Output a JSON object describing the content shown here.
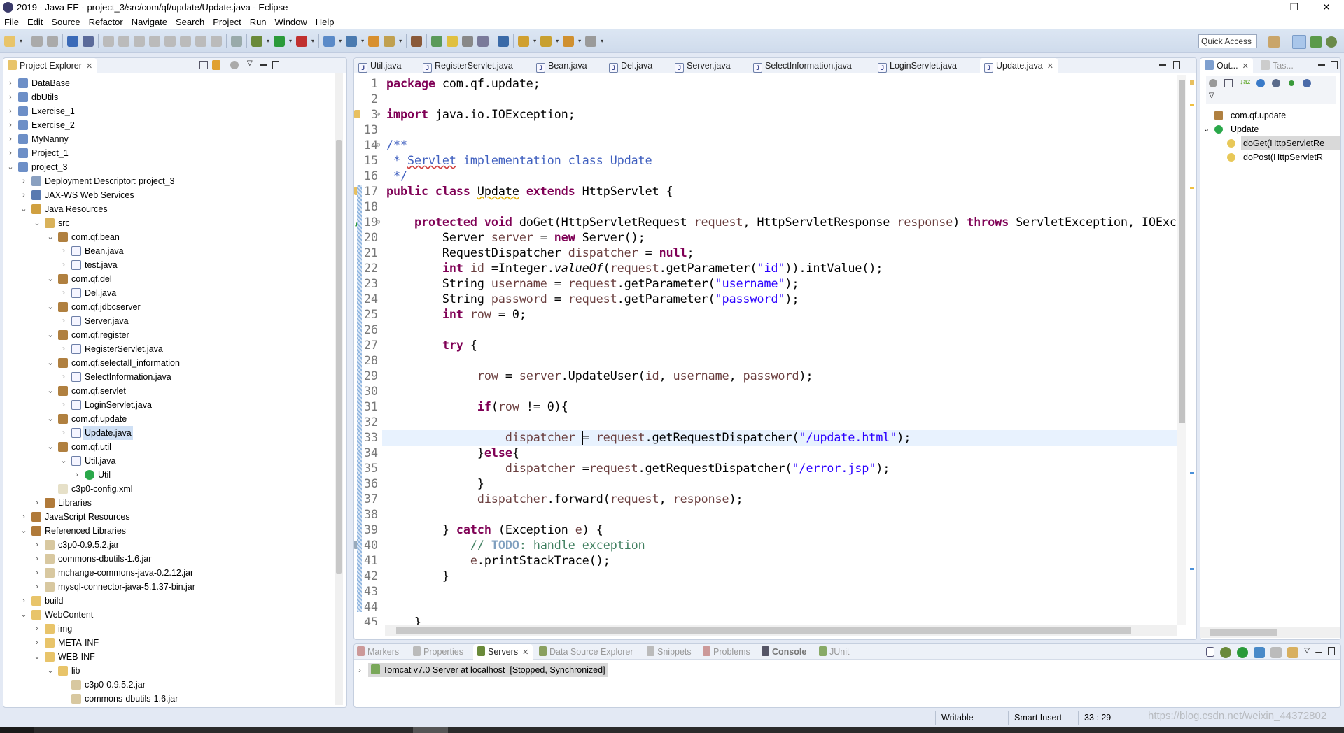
{
  "window": {
    "title": "2019 - Java EE - project_3/src/com/qf/update/Update.java - Eclipse"
  },
  "menu": [
    "File",
    "Edit",
    "Source",
    "Refactor",
    "Navigate",
    "Search",
    "Project",
    "Run",
    "Window",
    "Help"
  ],
  "toolbar": {
    "icons": [
      "new-icon",
      "save-icon",
      "save-all-icon",
      "open-perspective-icon",
      "skip-breakpoints-icon",
      "resume-icon",
      "suspend-icon",
      "terminate-icon",
      "disconnect-icon",
      "step-into-icon",
      "step-over-icon",
      "step-return-icon",
      "drop-to-frame-icon",
      "use-step-filters-icon",
      "debug-icon",
      "run-icon",
      "run-server-icon",
      "new-server-icon",
      "new-web-service-icon",
      "open-type-icon",
      "open-task-icon",
      "search-icon",
      "toggle-breadcrumb-icon",
      "mark-occurrences-icon",
      "block-selection-icon",
      "show-whitespace-icon",
      "web-browser-icon",
      "next-annotation-icon",
      "prev-annotation-icon",
      "back-icon",
      "forward-icon"
    ],
    "quick_access": "Quick Access"
  },
  "project_explorer": {
    "title": "Project Explorer",
    "items": [
      {
        "label": "DataBase",
        "level": 0,
        "expanded": false,
        "icon": "project"
      },
      {
        "label": "dbUtils",
        "level": 0,
        "expanded": false,
        "icon": "project"
      },
      {
        "label": "Exercise_1",
        "level": 0,
        "expanded": false,
        "icon": "project"
      },
      {
        "label": "Exercise_2",
        "level": 0,
        "expanded": false,
        "icon": "project"
      },
      {
        "label": "MyNanny",
        "level": 0,
        "expanded": false,
        "icon": "project"
      },
      {
        "label": "Project_1",
        "level": 0,
        "expanded": false,
        "icon": "project"
      },
      {
        "label": "project_3",
        "level": 0,
        "expanded": true,
        "icon": "project"
      },
      {
        "label": "Deployment Descriptor: project_3",
        "level": 1,
        "expanded": false,
        "icon": "descriptor"
      },
      {
        "label": "JAX-WS Web Services",
        "level": 1,
        "expanded": false,
        "icon": "webservice"
      },
      {
        "label": "Java Resources",
        "level": 1,
        "expanded": true,
        "icon": "resources"
      },
      {
        "label": "src",
        "level": 2,
        "expanded": true,
        "icon": "srcfolder"
      },
      {
        "label": "com.qf.bean",
        "level": 3,
        "expanded": true,
        "icon": "package"
      },
      {
        "label": "Bean.java",
        "level": 4,
        "expanded": false,
        "icon": "java"
      },
      {
        "label": "test.java",
        "level": 4,
        "expanded": false,
        "icon": "java"
      },
      {
        "label": "com.qf.del",
        "level": 3,
        "expanded": true,
        "icon": "package"
      },
      {
        "label": "Del.java",
        "level": 4,
        "expanded": false,
        "icon": "java"
      },
      {
        "label": "com.qf.jdbcserver",
        "level": 3,
        "expanded": true,
        "icon": "package"
      },
      {
        "label": "Server.java",
        "level": 4,
        "expanded": false,
        "icon": "java"
      },
      {
        "label": "com.qf.register",
        "level": 3,
        "expanded": true,
        "icon": "package"
      },
      {
        "label": "RegisterServlet.java",
        "level": 4,
        "expanded": false,
        "icon": "java"
      },
      {
        "label": "com.qf.selectall_information",
        "level": 3,
        "expanded": true,
        "icon": "package"
      },
      {
        "label": "SelectInformation.java",
        "level": 4,
        "expanded": false,
        "icon": "java"
      },
      {
        "label": "com.qf.servlet",
        "level": 3,
        "expanded": true,
        "icon": "package"
      },
      {
        "label": "LoginServlet.java",
        "level": 4,
        "expanded": false,
        "icon": "java"
      },
      {
        "label": "com.qf.update",
        "level": 3,
        "expanded": true,
        "icon": "package"
      },
      {
        "label": "Update.java",
        "level": 4,
        "expanded": false,
        "icon": "java",
        "selected": true
      },
      {
        "label": "com.qf.util",
        "level": 3,
        "expanded": true,
        "icon": "package"
      },
      {
        "label": "Util.java",
        "level": 4,
        "expanded": true,
        "icon": "java"
      },
      {
        "label": "Util",
        "level": 5,
        "expanded": false,
        "icon": "class"
      },
      {
        "label": "c3p0-config.xml",
        "level": 3,
        "expanded": null,
        "icon": "xml"
      },
      {
        "label": "Libraries",
        "level": 2,
        "expanded": false,
        "icon": "library"
      },
      {
        "label": "JavaScript Resources",
        "level": 1,
        "expanded": false,
        "icon": "library"
      },
      {
        "label": "Referenced Libraries",
        "level": 1,
        "expanded": true,
        "icon": "library"
      },
      {
        "label": "c3p0-0.9.5.2.jar",
        "level": 2,
        "expanded": false,
        "icon": "jar"
      },
      {
        "label": "commons-dbutils-1.6.jar",
        "level": 2,
        "expanded": false,
        "icon": "jar"
      },
      {
        "label": "mchange-commons-java-0.2.12.jar",
        "level": 2,
        "expanded": false,
        "icon": "jar"
      },
      {
        "label": "mysql-connector-java-5.1.37-bin.jar",
        "level": 2,
        "expanded": false,
        "icon": "jar"
      },
      {
        "label": "build",
        "level": 1,
        "expanded": false,
        "icon": "folder"
      },
      {
        "label": "WebContent",
        "level": 1,
        "expanded": true,
        "icon": "folder"
      },
      {
        "label": "img",
        "level": 2,
        "expanded": false,
        "icon": "folder"
      },
      {
        "label": "META-INF",
        "level": 2,
        "expanded": false,
        "icon": "folder"
      },
      {
        "label": "WEB-INF",
        "level": 2,
        "expanded": true,
        "icon": "folder"
      },
      {
        "label": "lib",
        "level": 3,
        "expanded": true,
        "icon": "folder"
      },
      {
        "label": "c3p0-0.9.5.2.jar",
        "level": 4,
        "expanded": null,
        "icon": "jar"
      },
      {
        "label": "commons-dbutils-1.6.jar",
        "level": 4,
        "expanded": null,
        "icon": "jar"
      }
    ]
  },
  "editor": {
    "tabs": [
      "Util.java",
      "RegisterServlet.java",
      "Bean.java",
      "Del.java",
      "Server.java",
      "SelectInformation.java",
      "LoginServlet.java",
      "Update.java"
    ],
    "active_tab": "Update.java",
    "current_line": 33,
    "lines": [
      {
        "n": 1,
        "segs": [
          [
            "k",
            "package"
          ],
          [
            "",
            " com.qf.update;"
          ]
        ]
      },
      {
        "n": 2,
        "segs": []
      },
      {
        "n": 3,
        "fold": "+",
        "segs": [
          [
            "k",
            "import"
          ],
          [
            "",
            " java.io.IOException;"
          ]
        ]
      },
      {
        "n": 13,
        "segs": []
      },
      {
        "n": 14,
        "fold": "-",
        "segs": [
          [
            "c",
            "/**"
          ]
        ]
      },
      {
        "n": 15,
        "segs": [
          [
            "c",
            " * "
          ],
          [
            "cu",
            "Servlet"
          ],
          [
            "c",
            " implementation class Update"
          ]
        ]
      },
      {
        "n": 16,
        "segs": [
          [
            "c",
            " */"
          ]
        ]
      },
      {
        "n": 17,
        "segs": [
          [
            "k",
            "public class "
          ],
          [
            "wu",
            "Update"
          ],
          [
            "k",
            " extends"
          ],
          [
            "",
            " HttpServlet {"
          ]
        ]
      },
      {
        "n": 18,
        "segs": []
      },
      {
        "n": 19,
        "fold": "-",
        "segs": [
          [
            "",
            "    "
          ],
          [
            "k",
            "protected void"
          ],
          [
            "",
            " doGet(HttpServletRequest "
          ],
          [
            "v",
            "request"
          ],
          [
            "",
            ", HttpServletResponse "
          ],
          [
            "v",
            "response"
          ],
          [
            "",
            ") "
          ],
          [
            "k",
            "throws"
          ],
          [
            "",
            " ServletException, IOException {"
          ]
        ]
      },
      {
        "n": 20,
        "segs": [
          [
            "",
            "        Server "
          ],
          [
            "v",
            "server"
          ],
          [
            "",
            " = "
          ],
          [
            "k",
            "new"
          ],
          [
            "",
            " Server();"
          ]
        ]
      },
      {
        "n": 21,
        "segs": [
          [
            "",
            "        RequestDispatcher "
          ],
          [
            "v",
            "dispatcher"
          ],
          [
            "",
            " = "
          ],
          [
            "k",
            "null"
          ],
          [
            "",
            ";"
          ]
        ]
      },
      {
        "n": 22,
        "segs": [
          [
            "",
            "        "
          ],
          [
            "k",
            "int"
          ],
          [
            "",
            " "
          ],
          [
            "v",
            "id"
          ],
          [
            "",
            " =Integer."
          ],
          [
            "it",
            "valueOf"
          ],
          [
            "",
            "("
          ],
          [
            "v",
            "request"
          ],
          [
            "",
            ".getParameter("
          ],
          [
            "s",
            "\"id\""
          ],
          [
            "",
            ")).intValue();"
          ]
        ]
      },
      {
        "n": 23,
        "segs": [
          [
            "",
            "        String "
          ],
          [
            "v",
            "username"
          ],
          [
            "",
            " = "
          ],
          [
            "v",
            "request"
          ],
          [
            "",
            ".getParameter("
          ],
          [
            "s",
            "\"username\""
          ],
          [
            "",
            ");"
          ]
        ]
      },
      {
        "n": 24,
        "segs": [
          [
            "",
            "        String "
          ],
          [
            "v",
            "password"
          ],
          [
            "",
            " = "
          ],
          [
            "v",
            "request"
          ],
          [
            "",
            ".getParameter("
          ],
          [
            "s",
            "\"password\""
          ],
          [
            "",
            ");"
          ]
        ]
      },
      {
        "n": 25,
        "segs": [
          [
            "",
            "        "
          ],
          [
            "k",
            "int"
          ],
          [
            "",
            " "
          ],
          [
            "v",
            "row"
          ],
          [
            "",
            " = 0;"
          ]
        ]
      },
      {
        "n": 26,
        "segs": []
      },
      {
        "n": 27,
        "segs": [
          [
            "",
            "        "
          ],
          [
            "k",
            "try"
          ],
          [
            "",
            " {"
          ]
        ]
      },
      {
        "n": 28,
        "segs": []
      },
      {
        "n": 29,
        "segs": [
          [
            "",
            "             "
          ],
          [
            "v",
            "row"
          ],
          [
            "",
            " = "
          ],
          [
            "v",
            "server"
          ],
          [
            "",
            ".UpdateUser("
          ],
          [
            "v",
            "id"
          ],
          [
            "",
            ", "
          ],
          [
            "v",
            "username"
          ],
          [
            "",
            ", "
          ],
          [
            "v",
            "password"
          ],
          [
            "",
            ");"
          ]
        ]
      },
      {
        "n": 30,
        "segs": []
      },
      {
        "n": 31,
        "segs": [
          [
            "",
            "             "
          ],
          [
            "k",
            "if"
          ],
          [
            "",
            "("
          ],
          [
            "v",
            "row"
          ],
          [
            "",
            " != 0){"
          ]
        ]
      },
      {
        "n": 32,
        "segs": []
      },
      {
        "n": 33,
        "segs": [
          [
            "",
            "                 "
          ],
          [
            "v",
            "dispatcher"
          ],
          [
            "",
            " = "
          ],
          [
            "v",
            "request"
          ],
          [
            "",
            ".getRequestDispatcher("
          ],
          [
            "s",
            "\"/update.html\""
          ],
          [
            "",
            ");"
          ]
        ]
      },
      {
        "n": 34,
        "segs": [
          [
            "",
            "             }"
          ],
          [
            "k",
            "else"
          ],
          [
            "",
            "{"
          ]
        ]
      },
      {
        "n": 35,
        "segs": [
          [
            "",
            "                 "
          ],
          [
            "v",
            "dispatcher"
          ],
          [
            "",
            " ="
          ],
          [
            "v",
            "request"
          ],
          [
            "",
            ".getRequestDispatcher("
          ],
          [
            "s",
            "\"/error.jsp\""
          ],
          [
            "",
            ");"
          ]
        ]
      },
      {
        "n": 36,
        "segs": [
          [
            "",
            "             }"
          ]
        ]
      },
      {
        "n": 37,
        "segs": [
          [
            "",
            "             "
          ],
          [
            "v",
            "dispatcher"
          ],
          [
            "",
            ".forward("
          ],
          [
            "v",
            "request"
          ],
          [
            "",
            ", "
          ],
          [
            "v",
            "response"
          ],
          [
            "",
            ");"
          ]
        ]
      },
      {
        "n": 38,
        "segs": []
      },
      {
        "n": 39,
        "segs": [
          [
            "",
            "        } "
          ],
          [
            "k",
            "catch"
          ],
          [
            "",
            " (Exception "
          ],
          [
            "v",
            "e"
          ],
          [
            "",
            ") {"
          ]
        ]
      },
      {
        "n": 40,
        "segs": [
          [
            "",
            "            "
          ],
          [
            "lc",
            "// "
          ],
          [
            "td",
            "TODO"
          ],
          [
            "lc",
            ": handle exception"
          ]
        ]
      },
      {
        "n": 41,
        "segs": [
          [
            "",
            "            "
          ],
          [
            "v",
            "e"
          ],
          [
            "",
            ".printStackTrace();"
          ]
        ]
      },
      {
        "n": 42,
        "segs": [
          [
            "",
            "        }"
          ]
        ]
      },
      {
        "n": 43,
        "segs": []
      },
      {
        "n": 44,
        "segs": []
      },
      {
        "n": 45,
        "segs": [
          [
            "",
            "    }"
          ]
        ]
      }
    ]
  },
  "outline": {
    "tabs": [
      "Out...",
      "Tas..."
    ],
    "items": [
      {
        "label": "com.qf.update",
        "level": 0,
        "icon": "package"
      },
      {
        "label": "Update",
        "level": 0,
        "icon": "class",
        "expanded": true
      },
      {
        "label": "doGet(HttpServletRe",
        "level": 1,
        "icon": "method",
        "selected": true
      },
      {
        "label": "doPost(HttpServletR",
        "level": 1,
        "icon": "method"
      }
    ]
  },
  "bottom_panel": {
    "tabs": [
      "Markers",
      "Properties",
      "Servers",
      "Data Source Explorer",
      "Snippets",
      "Problems",
      "Console",
      "JUnit"
    ],
    "active_tab": "Servers",
    "servers": [
      {
        "name": "Tomcat v7.0 Server at localhost",
        "state": "[Stopped, Synchronized]"
      }
    ]
  },
  "status": {
    "writable": "Writable",
    "insert_mode": "Smart Insert",
    "position": "33 : 29"
  },
  "watermark": "https://blog.csdn.net/weixin_44372802",
  "colors": {
    "keyword": "#7f0055",
    "string": "#2a00ff",
    "variable": "#6a3e3e",
    "javadoc": "#3f5fbf",
    "comment": "#3f7f5f",
    "current_line": "#e8f2fe",
    "selection": "#cfe0f5"
  }
}
